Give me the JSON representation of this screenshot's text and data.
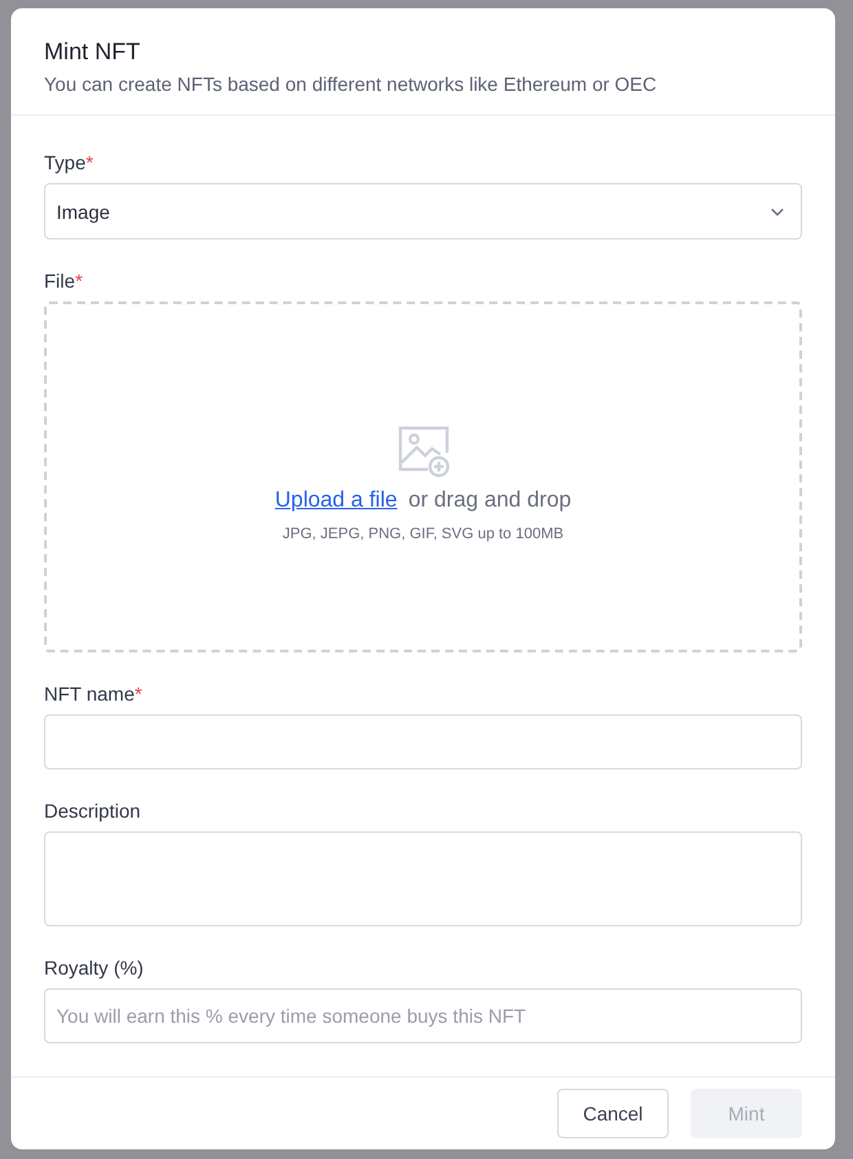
{
  "dialog": {
    "title": "Mint NFT",
    "subtitle": "You can create NFTs based on different networks like Ethereum or OEC"
  },
  "fields": [
    {
      "kind": "select",
      "label": "Type",
      "required_mark": "*",
      "value": "Image"
    },
    {
      "kind": "upload",
      "label": "File",
      "required_mark": "*",
      "link": "Upload a file",
      "text": "or drag and drop",
      "hint": "JPG, JEPG, PNG, GIF, SVG up to 100MB"
    },
    {
      "kind": "text",
      "label": "NFT name",
      "required_mark": "*"
    },
    {
      "kind": "textarea",
      "label": "Description"
    },
    {
      "kind": "text",
      "label": "Royalty (%)",
      "placeholder": "You will earn this % every time someone buys this NFT"
    }
  ],
  "buttons": [
    {
      "label": "Cancel",
      "disabled": false
    },
    {
      "label": "Mint",
      "disabled": true
    }
  ]
}
